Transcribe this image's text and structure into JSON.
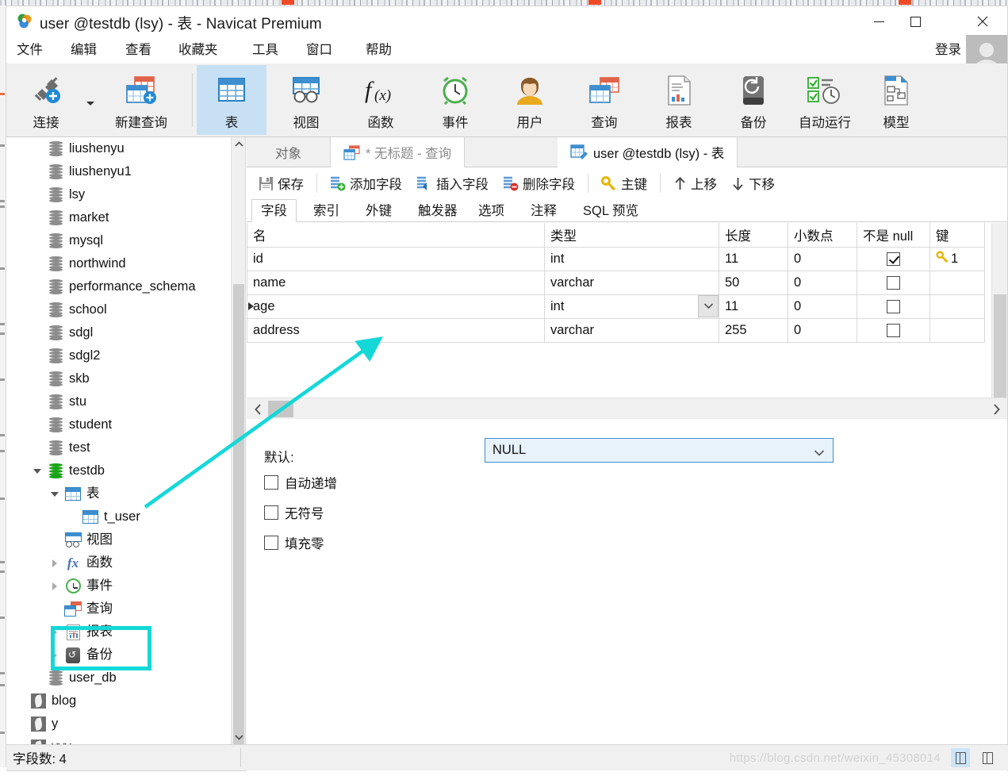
{
  "window": {
    "title": "user @testdb (lsy) - 表 - Navicat Premium",
    "minimize_label": "最小化",
    "maximize_label": "最大化",
    "close_label": "关闭"
  },
  "menubar": {
    "items": [
      {
        "label": "文件"
      },
      {
        "label": "编辑"
      },
      {
        "label": "查看"
      },
      {
        "label": "收藏夹"
      },
      {
        "label": "工具"
      },
      {
        "label": "窗口"
      },
      {
        "label": "帮助"
      }
    ],
    "login_label": "登录"
  },
  "ribbon": {
    "buttons": [
      {
        "label": "连接",
        "icon": "plug-plus-icon",
        "active": false
      },
      {
        "label": "新建查询",
        "icon": "new-query-icon",
        "active": false
      },
      {
        "label": "表",
        "icon": "table-icon",
        "active": true
      },
      {
        "label": "视图",
        "icon": "view-icon",
        "active": false
      },
      {
        "label": "函数",
        "icon": "function-fx-icon",
        "active": false
      },
      {
        "label": "事件",
        "icon": "clock-icon",
        "active": false
      },
      {
        "label": "用户",
        "icon": "user-icon",
        "active": false
      },
      {
        "label": "查询",
        "icon": "query-icon",
        "active": false
      },
      {
        "label": "报表",
        "icon": "report-icon",
        "active": false
      },
      {
        "label": "备份",
        "icon": "backup-icon",
        "active": false
      },
      {
        "label": "自动运行",
        "icon": "automation-icon",
        "active": false
      },
      {
        "label": "模型",
        "icon": "model-icon",
        "active": false
      }
    ]
  },
  "sidebar": {
    "tree": [
      {
        "label": "liushenyu",
        "icon": "database-icon",
        "indent": 1,
        "twisty": "none"
      },
      {
        "label": "liushenyu1",
        "icon": "database-icon",
        "indent": 1,
        "twisty": "none"
      },
      {
        "label": "lsy",
        "icon": "database-icon",
        "indent": 1,
        "twisty": "none"
      },
      {
        "label": "market",
        "icon": "database-icon",
        "indent": 1,
        "twisty": "none"
      },
      {
        "label": "mysql",
        "icon": "database-icon",
        "indent": 1,
        "twisty": "none"
      },
      {
        "label": "northwind",
        "icon": "database-icon",
        "indent": 1,
        "twisty": "none"
      },
      {
        "label": "performance_schema",
        "icon": "database-icon",
        "indent": 1,
        "twisty": "none"
      },
      {
        "label": "school",
        "icon": "database-icon",
        "indent": 1,
        "twisty": "none"
      },
      {
        "label": "sdgl",
        "icon": "database-icon",
        "indent": 1,
        "twisty": "none"
      },
      {
        "label": "sdgl2",
        "icon": "database-icon",
        "indent": 1,
        "twisty": "none"
      },
      {
        "label": "skb",
        "icon": "database-icon",
        "indent": 1,
        "twisty": "none"
      },
      {
        "label": "stu",
        "icon": "database-icon",
        "indent": 1,
        "twisty": "none"
      },
      {
        "label": "student",
        "icon": "database-icon",
        "indent": 1,
        "twisty": "none"
      },
      {
        "label": "test",
        "icon": "database-icon",
        "indent": 1,
        "twisty": "none"
      },
      {
        "label": "testdb",
        "icon": "database-open-icon",
        "indent": 1,
        "twisty": "down"
      },
      {
        "label": "表",
        "icon": "table-group-icon",
        "indent": 2,
        "twisty": "down"
      },
      {
        "label": "t_user",
        "icon": "table-icon",
        "indent": 3,
        "twisty": "none",
        "highlighted": true
      },
      {
        "label": "视图",
        "icon": "view-icon",
        "indent": 2,
        "twisty": "none"
      },
      {
        "label": "函数",
        "icon": "function-fx-icon",
        "indent": 2,
        "twisty": "right"
      },
      {
        "label": "事件",
        "icon": "clock-icon",
        "indent": 2,
        "twisty": "right"
      },
      {
        "label": "查询",
        "icon": "query-icon",
        "indent": 2,
        "twisty": "none"
      },
      {
        "label": "报表",
        "icon": "report-icon",
        "indent": 2,
        "twisty": "right"
      },
      {
        "label": "备份",
        "icon": "backup-icon",
        "indent": 2,
        "twisty": "right"
      },
      {
        "label": "user_db",
        "icon": "database-icon",
        "indent": 1,
        "twisty": "none"
      },
      {
        "label": "blog",
        "icon": "feather-icon",
        "indent": 0,
        "twisty": "none"
      },
      {
        "label": "y",
        "icon": "feather-icon",
        "indent": 0,
        "twisty": "none"
      },
      {
        "label": "yyy",
        "icon": "feather-icon",
        "indent": 0,
        "twisty": "none"
      }
    ]
  },
  "tabs": [
    {
      "label": "对象",
      "icon": "none",
      "active": false
    },
    {
      "label": "* 无标题 - 查询",
      "icon": "query-icon",
      "active": false
    },
    {
      "label": "user @testdb (lsy) - 表",
      "icon": "table-design-icon",
      "active": true
    }
  ],
  "editor_toolbar": {
    "buttons": [
      {
        "label": "保存",
        "icon": "save-icon"
      },
      {
        "label": "添加字段",
        "icon": "add-field-icon"
      },
      {
        "label": "插入字段",
        "icon": "insert-field-icon"
      },
      {
        "label": "删除字段",
        "icon": "delete-field-icon"
      },
      {
        "label": "主键",
        "icon": "key-icon"
      },
      {
        "label": "上移",
        "icon": "arrow-up-icon"
      },
      {
        "label": "下移",
        "icon": "arrow-down-icon"
      }
    ]
  },
  "sub_tabs": [
    {
      "label": "字段",
      "active": true
    },
    {
      "label": "索引",
      "active": false
    },
    {
      "label": "外键",
      "active": false
    },
    {
      "label": "触发器",
      "active": false
    },
    {
      "label": "选项",
      "active": false
    },
    {
      "label": "注释",
      "active": false
    },
    {
      "label": "SQL 预览",
      "active": false
    }
  ],
  "grid": {
    "columns": [
      "名",
      "类型",
      "长度",
      "小数点",
      "不是 null",
      "键"
    ],
    "rows": [
      {
        "name": "id",
        "type": "int",
        "length": "11",
        "decimals": "0",
        "not_null": true,
        "key": "1",
        "selected": false,
        "type_dropdown": false
      },
      {
        "name": "name",
        "type": "varchar",
        "length": "50",
        "decimals": "0",
        "not_null": false,
        "key": "",
        "selected": false,
        "type_dropdown": false
      },
      {
        "name": "age",
        "type": "int",
        "length": "11",
        "decimals": "0",
        "not_null": false,
        "key": "",
        "selected": true,
        "type_dropdown": true
      },
      {
        "name": "address",
        "type": "varchar",
        "length": "255",
        "decimals": "0",
        "not_null": false,
        "key": "",
        "selected": false,
        "type_dropdown": false
      }
    ]
  },
  "properties": {
    "default_label": "默认:",
    "default_value": "NULL",
    "checkboxes": [
      {
        "label": "自动递增",
        "checked": false
      },
      {
        "label": "无符号",
        "checked": false
      },
      {
        "label": "填充零",
        "checked": false
      }
    ]
  },
  "statusbar": {
    "field_count_text": "字段数: 4",
    "watermark": "https://blog.csdn.net/weixin_45308014"
  },
  "annotation": {
    "color": "#14d8d8",
    "highlight_target": "t_user"
  }
}
